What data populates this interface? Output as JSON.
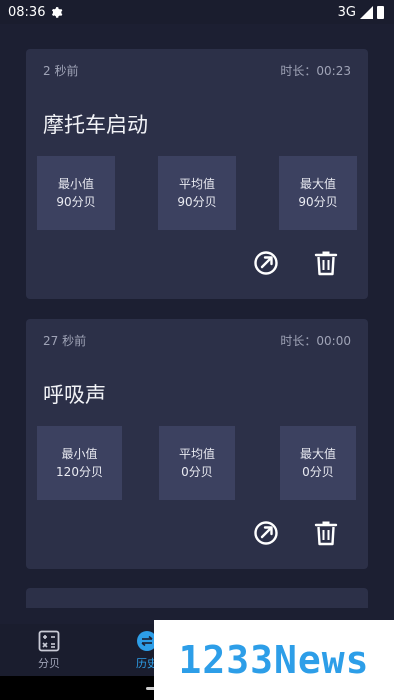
{
  "status_bar": {
    "time": "08:36",
    "network": "3G"
  },
  "records": [
    {
      "time_ago": "2 秒前",
      "duration": "时长：00:23",
      "title": "摩托车启动",
      "stats": [
        {
          "label": "最小值",
          "value": "90分贝"
        },
        {
          "label": "平均值",
          "value": "90分贝"
        },
        {
          "label": "最大值",
          "value": "90分贝"
        }
      ]
    },
    {
      "time_ago": "27 秒前",
      "duration": "时长：00:00",
      "title": "呼吸声",
      "stats": [
        {
          "label": "最小值",
          "value": "120分贝"
        },
        {
          "label": "平均值",
          "value": "0分贝"
        },
        {
          "label": "最大值",
          "value": "0分贝"
        }
      ]
    }
  ],
  "bottom_nav": {
    "items": [
      {
        "label": "分贝",
        "icon": "calculator-icon"
      },
      {
        "label": "历史",
        "icon": "history-icon"
      }
    ]
  },
  "watermark": {
    "text": "1233News"
  },
  "colors": {
    "accent": "#2d9ee8",
    "card": "#2c3048",
    "background": "#1c1f32"
  }
}
